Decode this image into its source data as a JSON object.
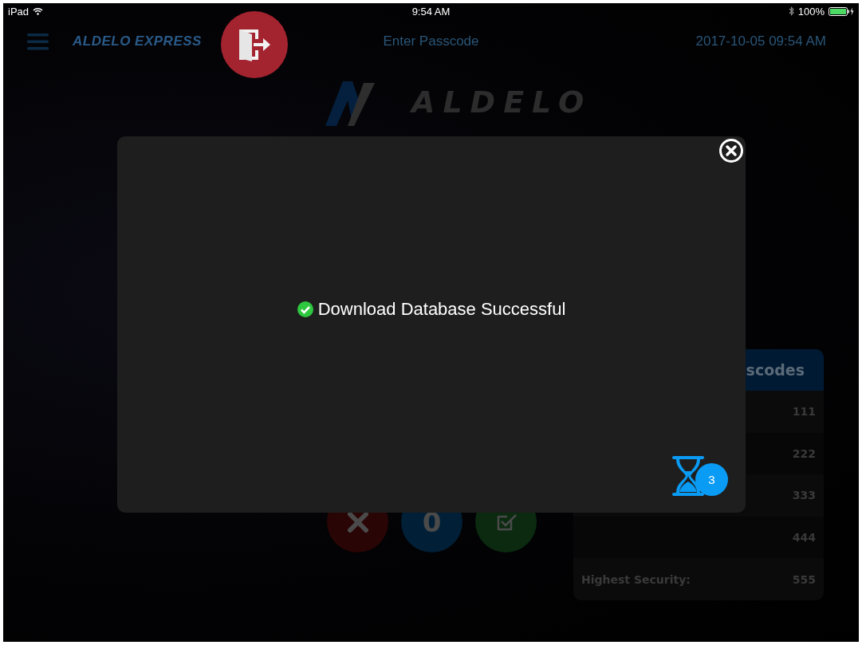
{
  "status_bar": {
    "device": "iPad",
    "time": "9:54 AM",
    "battery": "100%"
  },
  "header": {
    "brand": "ALDELO EXPRESS",
    "title": "Enter Passcode",
    "datetime": "2017-10-05 09:54 AM"
  },
  "logo": {
    "text": "ALDELO"
  },
  "keypad_buttons": [
    {
      "kind": "clear"
    },
    {
      "kind": "count",
      "label": "0"
    },
    {
      "kind": "confirm"
    }
  ],
  "passcodes_panel": {
    "title": "scodes",
    "rows": [
      {
        "value": "111"
      },
      {
        "value": "222"
      },
      {
        "value": "333"
      },
      {
        "value": "444"
      },
      {
        "label": "Highest Security:",
        "value": "555"
      }
    ]
  },
  "dialog": {
    "message": "Download Database Successful",
    "countdown": "3"
  }
}
